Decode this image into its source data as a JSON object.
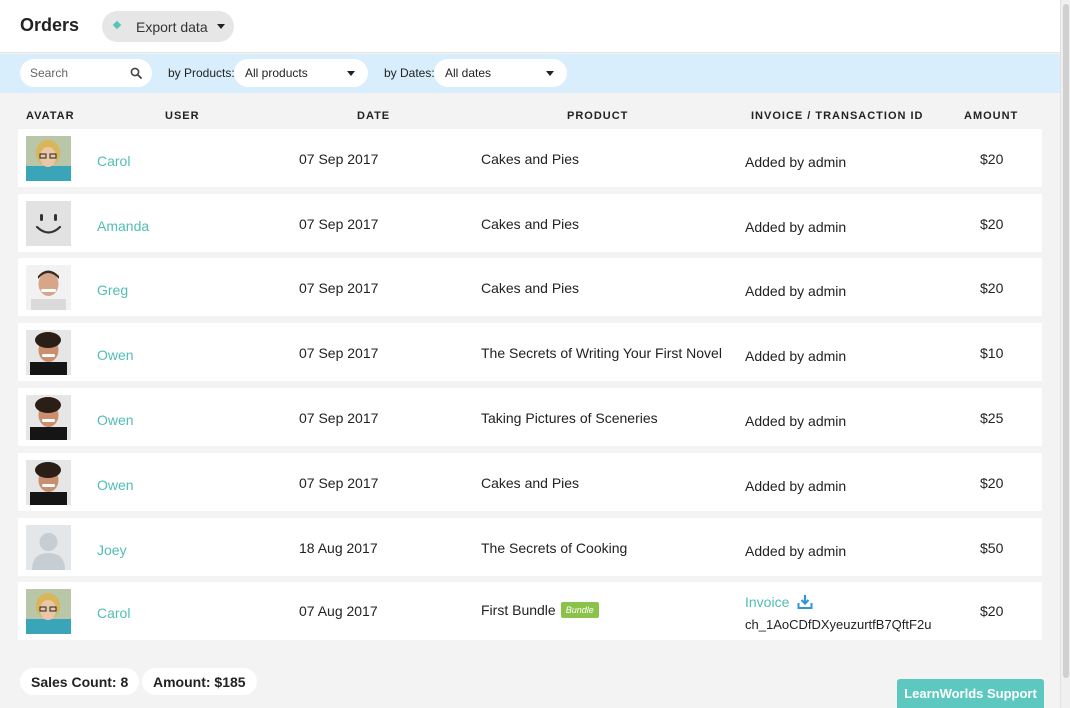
{
  "header": {
    "title": "Orders",
    "export_label": "Export data"
  },
  "filters": {
    "search_placeholder": "Search",
    "products_label": "by Products:",
    "products_value": "All products",
    "dates_label": "by Dates:",
    "dates_value": "All dates"
  },
  "columns": {
    "avatar": "AVATAR",
    "user": "USER",
    "date": "DATE",
    "product": "PRODUCT",
    "invoice": "INVOICE / TRANSACTION ID",
    "amount": "AMOUNT"
  },
  "rows": [
    {
      "avatar": "woman-blonde-glasses",
      "user": "Carol",
      "date": "07 Sep 2017",
      "product": "Cakes and Pies",
      "invoice": "Added by admin",
      "amount": "$20"
    },
    {
      "avatar": "smiley-face",
      "user": "Amanda",
      "date": "07 Sep 2017",
      "product": "Cakes and Pies",
      "invoice": "Added by admin",
      "amount": "$20"
    },
    {
      "avatar": "man-smiling",
      "user": "Greg",
      "date": "07 Sep 2017",
      "product": "Cakes and Pies",
      "invoice": "Added by admin",
      "amount": "$20"
    },
    {
      "avatar": "man-curly-hair",
      "user": "Owen",
      "date": "07 Sep 2017",
      "product": "The Secrets of Writing Your First Novel",
      "invoice": "Added by admin",
      "amount": "$10"
    },
    {
      "avatar": "man-curly-hair",
      "user": "Owen",
      "date": "07 Sep 2017",
      "product": "Taking Pictures of Sceneries",
      "invoice": "Added by admin",
      "amount": "$25"
    },
    {
      "avatar": "man-curly-hair",
      "user": "Owen",
      "date": "07 Sep 2017",
      "product": "Cakes and Pies",
      "invoice": "Added by admin",
      "amount": "$20"
    },
    {
      "avatar": "default-silhouette",
      "user": "Joey",
      "date": "18 Aug 2017",
      "product": "The Secrets of Cooking",
      "invoice": "Added by admin",
      "amount": "$50"
    },
    {
      "avatar": "woman-blonde-glasses",
      "user": "Carol",
      "date": "07 Aug 2017",
      "product": "First Bundle",
      "badge": "Bundle",
      "invoice_link": "Invoice",
      "transaction_id": "ch_1AoCDfDXyeuzurtfB7QftF2u",
      "amount": "$20"
    }
  ],
  "summary": {
    "sales_count": "Sales Count: 8",
    "amount": "Amount: $185"
  },
  "support": {
    "label": "LearnWorlds Support"
  },
  "colors": {
    "accent": "#52bdb5",
    "filter_bar": "#d9eefc",
    "bundle_badge": "#8bc34a",
    "support_button": "#5cc8c0"
  }
}
